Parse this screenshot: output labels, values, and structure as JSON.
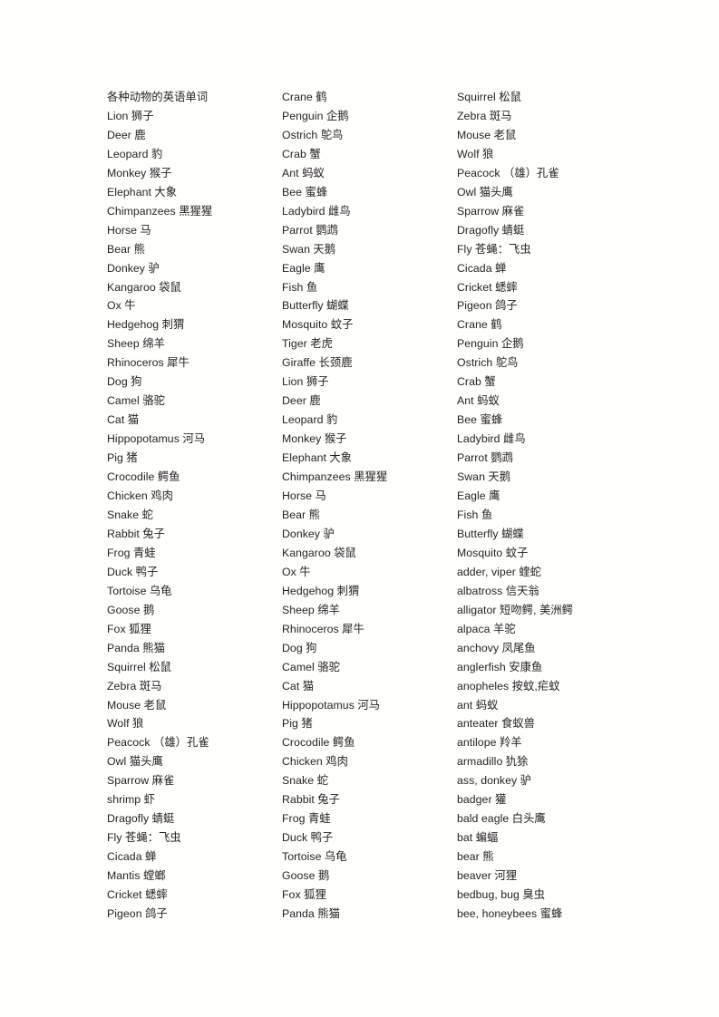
{
  "document": {
    "title": "各种动物的英语单词",
    "columns": [
      {
        "name": "column-1",
        "entries": [
          "各种动物的英语单词",
          "Lion 狮子",
          "Deer 鹿",
          "Leopard 豹",
          "Monkey 猴子",
          "Elephant 大象",
          "Chimpanzees 黑猩猩",
          "Horse 马",
          "Bear 熊",
          "Donkey 驴",
          "Kangaroo 袋鼠",
          "Ox 牛",
          "Hedgehog 刺猬",
          "Sheep 绵羊",
          "Rhinoceros 犀牛",
          "Dog 狗",
          "Camel 骆驼",
          "Cat 猫",
          "Hippopotamus 河马",
          "Pig 猪",
          "Crocodile 鳄鱼",
          "Chicken 鸡肉",
          "Snake 蛇",
          "Rabbit 兔子",
          "Frog 青蛙",
          "Duck 鸭子",
          "Tortoise 乌龟",
          "Goose 鹅",
          "Fox 狐狸",
          "Panda 熊猫",
          "Squirrel 松鼠",
          "Zebra 斑马",
          "Mouse 老鼠",
          "Wolf 狼",
          "Peacock （雄）孔雀",
          "Owl 猫头鹰",
          "Sparrow 麻雀",
          "shrimp 虾",
          "Dragofly 蜻蜓",
          "Fly 苍蝇：飞虫",
          "Cicada 蝉",
          "Mantis 螳螂",
          "Cricket 蟋蟀",
          "Pigeon 鸽子"
        ]
      },
      {
        "name": "column-2",
        "entries": [
          "Crane 鹤",
          "Penguin 企鹅",
          "Ostrich 鸵鸟",
          "Crab 蟹",
          "Ant 蚂蚁",
          "Bee 蜜蜂",
          "Ladybird 雌鸟",
          "Parrot 鹦鹉",
          "Swan 天鹅",
          "Eagle 鹰",
          "Fish 鱼",
          "Butterfly 蝴蝶",
          "Mosquito 蚊子",
          "Tiger 老虎",
          "Giraffe 长颈鹿",
          "Lion 狮子",
          "Deer 鹿",
          "Leopard 豹",
          "Monkey 猴子",
          "Elephant 大象",
          "Chimpanzees 黑猩猩",
          "Horse 马",
          "Bear 熊",
          "Donkey 驴",
          "Kangaroo 袋鼠",
          "Ox 牛",
          "Hedgehog 刺猬",
          "Sheep 绵羊",
          "Rhinoceros 犀牛",
          "Dog 狗",
          "Camel 骆驼",
          "Cat 猫",
          "Hippopotamus 河马",
          "Pig 猪",
          "Crocodile 鳄鱼",
          "Chicken 鸡肉",
          "Snake 蛇",
          "Rabbit 兔子",
          "Frog 青蛙",
          "Duck 鸭子",
          "Tortoise 乌龟",
          "Goose 鹅",
          "Fox 狐狸",
          "Panda 熊猫"
        ]
      },
      {
        "name": "column-3",
        "entries": [
          "Squirrel 松鼠",
          "Zebra 斑马",
          "Mouse 老鼠",
          "Wolf 狼",
          "Peacock （雄）孔雀",
          "Owl 猫头鹰",
          "Sparrow 麻雀",
          "Dragofly 蜻蜓",
          "Fly 苍蝇：飞虫",
          "Cicada 蝉",
          "Cricket 蟋蟀",
          "Pigeon 鸽子",
          "Crane 鹤",
          "Penguin 企鹅",
          "Ostrich 鸵鸟",
          "Crab 蟹",
          "Ant 蚂蚁",
          "Bee 蜜蜂",
          "Ladybird 雌鸟",
          "Parrot 鹦鹉",
          "Swan 天鹅",
          "Eagle 鹰",
          "Fish 鱼",
          "Butterfly 蝴蝶",
          "Mosquito 蚊子",
          "adder, viper 蝰蛇",
          "albatross 信天翁",
          "alligator 短吻鳄, 美洲鳄",
          "alpaca 羊驼",
          "anchovy 凤尾鱼",
          "anglerfish 安康鱼",
          "anopheles 按蚊,疟蚊",
          "ant 蚂蚁",
          "anteater 食蚁兽",
          "antilope 羚羊",
          "armadillo 犰狳",
          "ass, donkey 驴",
          "badger 獾",
          "bald eagle 白头鹰",
          "bat 蝙蝠",
          "bear 熊",
          "beaver 河狸",
          "bedbug, bug 臭虫",
          "bee, honeybees 蜜蜂"
        ]
      }
    ]
  }
}
